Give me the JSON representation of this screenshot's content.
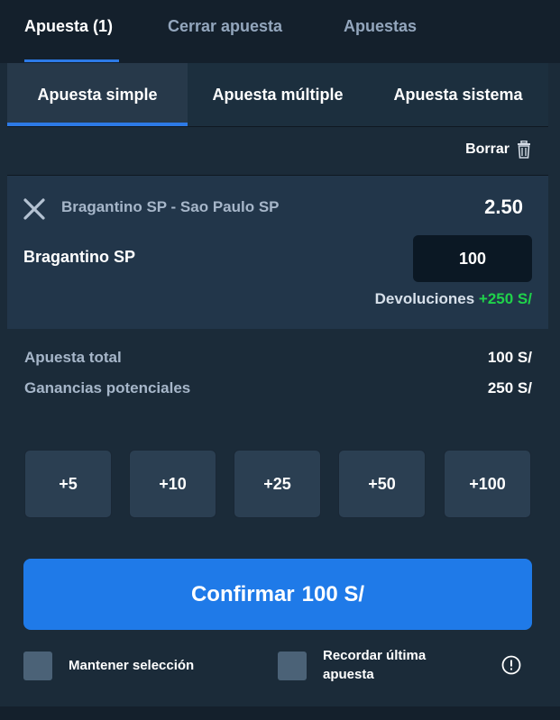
{
  "top_tabs": [
    {
      "label": "Apuesta (1)",
      "active": true
    },
    {
      "label": "Cerrar apuesta",
      "active": false
    },
    {
      "label": "Apuestas",
      "active": false
    }
  ],
  "sub_tabs": [
    {
      "label": "Apuesta simple",
      "active": true
    },
    {
      "label": "Apuesta múltiple",
      "active": false
    },
    {
      "label": "Apuesta sistema",
      "active": false
    }
  ],
  "clear": {
    "label": "Borrar",
    "icon": "trash-icon"
  },
  "bet": {
    "match": "Bragantino SP - Sao Paulo SP",
    "odds": "2.50",
    "selection": "Bragantino SP",
    "stake": "100",
    "returns_label": "Devoluciones",
    "returns_value": "+250 S/"
  },
  "summary": {
    "total_label": "Apuesta total",
    "total_value": "100 S/",
    "potential_label": "Ganancias potenciales",
    "potential_value": "250 S/"
  },
  "quick_stakes": [
    "+5",
    "+10",
    "+25",
    "+50",
    "+100"
  ],
  "confirm": {
    "label": "Confirmar",
    "amount": "100 S/"
  },
  "options": {
    "keep_selection": "Mantener selección",
    "remember_line1": "Recordar última",
    "remember_line2": "apuesta"
  },
  "colors": {
    "accent": "#1f7ae8",
    "positive": "#1fd24a",
    "background": "#1b2b39"
  }
}
